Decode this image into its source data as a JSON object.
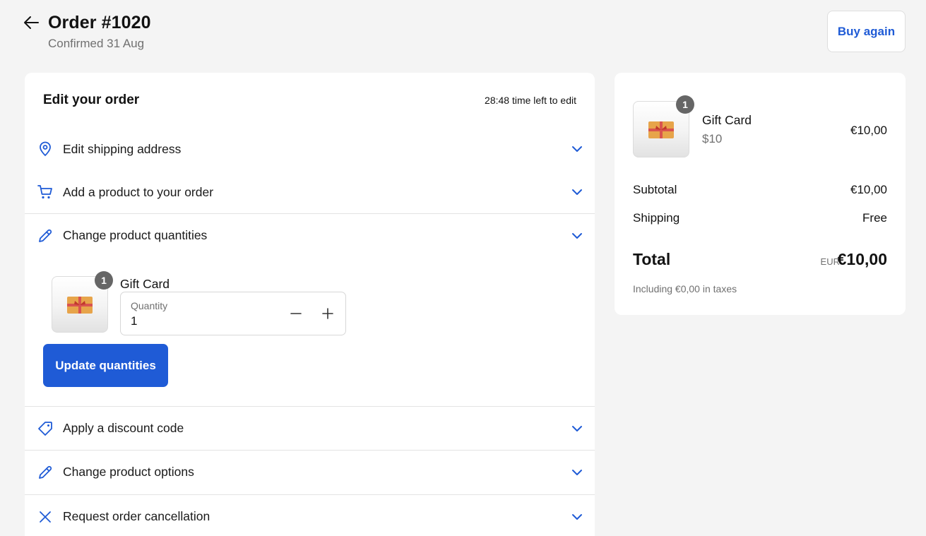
{
  "header": {
    "title": "Order #1020",
    "subtitle": "Confirmed 31 Aug",
    "buy_again": "Buy again"
  },
  "edit": {
    "title": "Edit your order",
    "time_left": "28:48 time left to edit",
    "sections": {
      "shipping": "Edit shipping address",
      "add_product": "Add a product to your order",
      "quantities": "Change product quantities",
      "discount": "Apply a discount code",
      "options": "Change product options",
      "cancel": "Request order cancellation"
    },
    "item": {
      "name": "Gift Card",
      "badge": "1",
      "quantity_label": "Quantity",
      "quantity_value": "1"
    },
    "update_button": "Update quantities"
  },
  "summary": {
    "item": {
      "name": "Gift Card",
      "variant": "$10",
      "price": "€10,00",
      "badge": "1"
    },
    "subtotal_label": "Subtotal",
    "subtotal_value": "€10,00",
    "shipping_label": "Shipping",
    "shipping_value": "Free",
    "total_label": "Total",
    "total_currency": "EUR",
    "total_value": "€10,00",
    "taxes_note": "Including €0,00 in taxes"
  },
  "colors": {
    "accent": "#1f5bd6",
    "background": "#f4f4f4",
    "badge": "#666666"
  }
}
